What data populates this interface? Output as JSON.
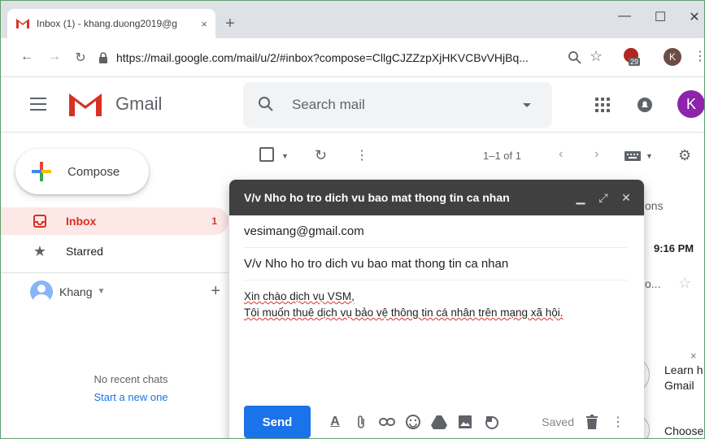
{
  "browser": {
    "tab_title": "Inbox (1) - khang.duong2019@g",
    "tab_close": "×",
    "new_tab": "+",
    "minimize": "—",
    "maximize": "☐",
    "close": "✕",
    "url": "https://mail.google.com/mail/u/2/#inbox?compose=CllgCJZZzpXjHKVCBvVHjBq...",
    "extension_badge": "29",
    "profile_initial": "K"
  },
  "gmail": {
    "logo_text": "Gmail",
    "search_placeholder": "Search mail",
    "avatar_initial": "K"
  },
  "sidebar": {
    "compose_label": "Compose",
    "items": [
      {
        "label": "Inbox",
        "count": "1"
      },
      {
        "label": "Starred",
        "count": ""
      }
    ],
    "hangouts_user": "Khang",
    "no_recent_chats": "No recent chats",
    "start_new": "Start a new one"
  },
  "list_toolbar": {
    "page_range": "1–1 of 1"
  },
  "background_fragments": {
    "tab_fragment": "ons",
    "time": "9:16 PM",
    "snippet": "o...",
    "promo_close": "×",
    "promo_text_1": "Learn h",
    "promo_text_2": "Gmail",
    "promo_text_3": "Choose"
  },
  "compose": {
    "title": "V/v Nho ho tro dich vu bao mat thong tin ca nhan",
    "to": "vesimang@gmail.com",
    "subject": "V/v Nho ho tro dich vu bao mat thong tin ca nhan",
    "body_line_1": "Xin chào dịch vụ VSM,",
    "body_line_2": "Tôi muốn thuê dịch vụ bảo vệ thông tin cá nhân trên mạng xã hội.",
    "send_label": "Send",
    "saved_label": "Saved"
  },
  "colors": {
    "gmail_red": "#d93025",
    "send_blue": "#1a73e8",
    "compose_header": "#404040",
    "avatar": "#8e24aa"
  }
}
